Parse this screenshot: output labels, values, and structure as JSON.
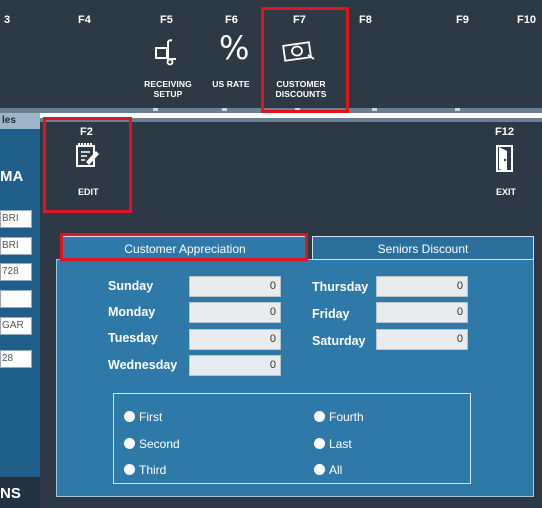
{
  "toolbar": {
    "keys": [
      {
        "key": "3"
      },
      {
        "key": "F4"
      },
      {
        "key": "F5",
        "label": "RECEIVING\nSETUP",
        "icon": "dolly-icon"
      },
      {
        "key": "F6",
        "label": "US RATE",
        "icon": "percent-icon"
      },
      {
        "key": "F7",
        "label": "CUSTOMER\nDISCOUNTS",
        "icon": "money-icon"
      },
      {
        "key": "F8"
      },
      {
        "key": "F9"
      },
      {
        "key": "F10"
      }
    ],
    "f5_line1": "RECEIVING",
    "f5_line2": "SETUP",
    "f6_label": "US RATE",
    "f7_line1": "CUSTOMER",
    "f7_line2": "DISCOUNTS",
    "percent_glyph": "%"
  },
  "background_window": {
    "tab_label": "les",
    "big_letters_1": "MA",
    "fields": [
      "BRI",
      "BRI",
      "728",
      "",
      "GAR",
      "28"
    ],
    "big_letters_2": "NS"
  },
  "dialog": {
    "edit_key": "F2",
    "edit_label": "EDIT",
    "edit_icon": "edit-icon",
    "exit_key": "F12",
    "exit_label": "EXIT",
    "exit_icon": "door-exit-icon"
  },
  "tabs": {
    "active": "Customer Appreciation",
    "inactive": "Seniors Discount"
  },
  "days": {
    "sunday": {
      "label": "Sunday",
      "value": "0"
    },
    "monday": {
      "label": "Monday",
      "value": "0"
    },
    "tuesday": {
      "label": "Tuesday",
      "value": "0"
    },
    "wednesday": {
      "label": "Wednesday",
      "value": "0"
    },
    "thursday": {
      "label": "Thursday",
      "value": "0"
    },
    "friday": {
      "label": "Friday",
      "value": "0"
    },
    "saturday": {
      "label": "Saturday",
      "value": "0"
    }
  },
  "week_options": {
    "first": "First",
    "second": "Second",
    "third": "Third",
    "fourth": "Fourth",
    "last": "Last",
    "all": "All"
  },
  "colors": {
    "toolbar_bg": "#2d3a45",
    "panel_bg": "#2f79a8",
    "highlight": "#e0141c"
  }
}
